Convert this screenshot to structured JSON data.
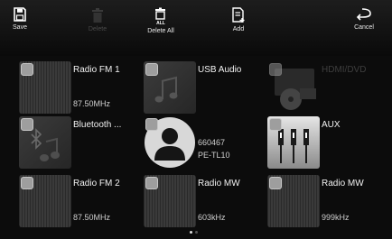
{
  "toolbar": {
    "save_label": "Save",
    "delete_label": "Delete",
    "delete_all_label": "Delete All",
    "add_label": "Add",
    "cancel_label": "Cancel"
  },
  "tiles": [
    {
      "title": "Radio FM 1",
      "subtitle": "87.50MHz",
      "icon": "radio-icon"
    },
    {
      "title": "USB Audio",
      "subtitle": "",
      "icon": "music-note-icon"
    },
    {
      "title": "HDMI/DVD",
      "subtitle": "",
      "icon": "hdmi-dvd-icon",
      "disabled": true
    },
    {
      "title": "Bluetooth ...",
      "subtitle": "",
      "icon": "bluetooth-audio-icon"
    },
    {
      "title": "",
      "subtitle": "660467",
      "subtitle2": "PE-TL10",
      "icon": "contact-icon"
    },
    {
      "title": "AUX",
      "subtitle": "",
      "icon": "rca-cable-icon"
    },
    {
      "title": "Radio FM 2",
      "subtitle": "87.50MHz",
      "icon": "radio-icon"
    },
    {
      "title": "Radio MW",
      "subtitle": "603kHz",
      "icon": "radio-icon"
    },
    {
      "title": "Radio MW",
      "subtitle": "999kHz",
      "icon": "radio-icon"
    }
  ],
  "pager": {
    "pages": 2,
    "current": 1
  },
  "colors": {
    "background": "#0c0c0c",
    "text": "#f0f0f0",
    "disabled": "#3e3e3e",
    "checkbox": "#9e9e9e"
  }
}
